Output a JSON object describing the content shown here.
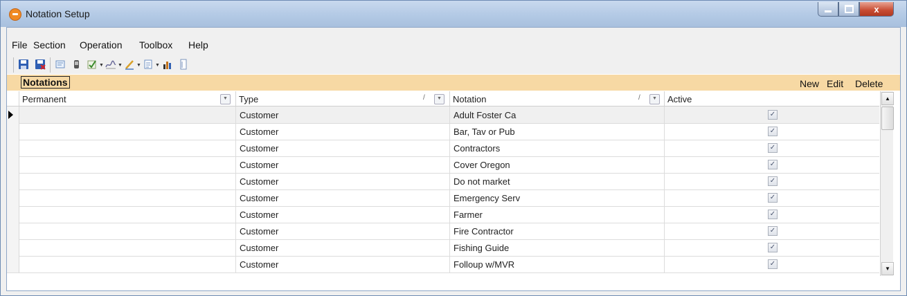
{
  "window": {
    "title": "Notation Setup",
    "minimize": "",
    "maximize": "",
    "close": "x"
  },
  "menu": [
    "File",
    "Section",
    "Operation",
    "Toolbox",
    "Help"
  ],
  "toolbar": {
    "icons": [
      "save-icon",
      "save-close-icon",
      "edit-document-icon",
      "phone-icon",
      "checklist-icon",
      "signature-icon",
      "pen-icon",
      "notes-icon",
      "reports-icon",
      "document-icon"
    ]
  },
  "notations_bar": {
    "title": "Notations",
    "actions": [
      "New",
      "Edit",
      "Delete"
    ]
  },
  "grid": {
    "columns": [
      "Permanent",
      "Type",
      "Notation",
      "Active"
    ],
    "rows": [
      {
        "permanent": "",
        "type": "Customer",
        "notation": "Adult Foster Ca",
        "active": true
      },
      {
        "permanent": "",
        "type": "Customer",
        "notation": "Bar, Tav or Pub",
        "active": true
      },
      {
        "permanent": "",
        "type": "Customer",
        "notation": "Contractors",
        "active": true
      },
      {
        "permanent": "",
        "type": "Customer",
        "notation": "Cover Oregon",
        "active": true
      },
      {
        "permanent": "",
        "type": "Customer",
        "notation": "Do not market",
        "active": true
      },
      {
        "permanent": "",
        "type": "Customer",
        "notation": "Emergency Serv",
        "active": true
      },
      {
        "permanent": "",
        "type": "Customer",
        "notation": "Farmer",
        "active": true
      },
      {
        "permanent": "",
        "type": "Customer",
        "notation": "Fire Contractor",
        "active": true
      },
      {
        "permanent": "",
        "type": "Customer",
        "notation": "Fishing Guide",
        "active": true
      },
      {
        "permanent": "",
        "type": "Customer",
        "notation": "Folloup w/MVR",
        "active": true
      }
    ],
    "selected_row": 0
  }
}
